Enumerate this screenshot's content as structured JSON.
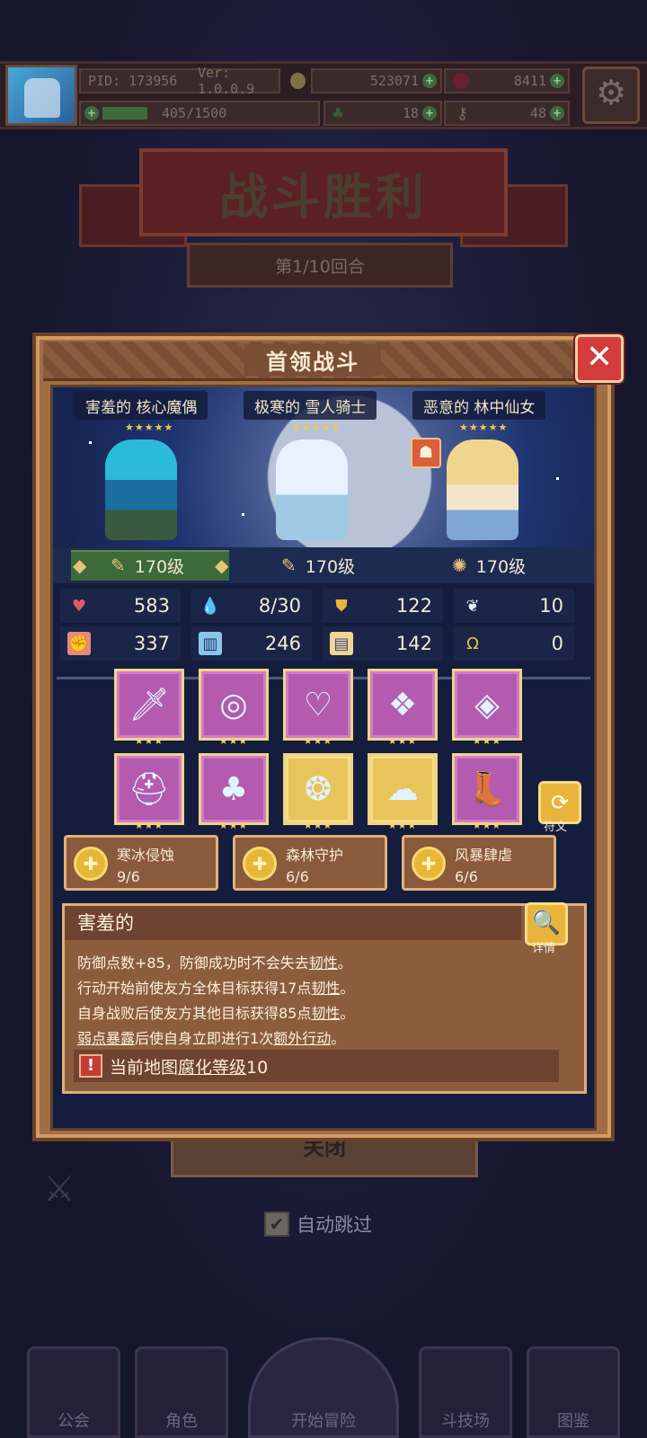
{
  "header": {
    "pid": "PID: 173956",
    "version": "Ver: 1.0.0.9",
    "gold": "523071",
    "gems": "8411",
    "energy": "405/1500",
    "clover": "18",
    "keys": "48"
  },
  "background": {
    "victory_title": "战斗胜利",
    "round": "第1/10回合",
    "close_label": "关闭",
    "auto_skip": "自动跳过",
    "nav": [
      "公会",
      "角色",
      "开始冒险",
      "斗技场",
      "图鉴"
    ]
  },
  "modal": {
    "title": "首领战斗",
    "heroes": [
      {
        "name": "害羞的 核心魔偶",
        "stars": "★★★★★",
        "level": "170级"
      },
      {
        "name": "极寒的 雪人骑士",
        "stars": "★★★★★",
        "level": "170级"
      },
      {
        "name": "恶意的 林中仙女",
        "stars": "★★★★★",
        "level": "170级"
      }
    ],
    "stats": {
      "hp": "583",
      "mana": "8/30",
      "defense": "122",
      "speed": "10",
      "attack": "337",
      "magic": "246",
      "armor": "142",
      "luck": "0"
    },
    "equipment_stars": "★★★",
    "rune_label": "符文",
    "sets": [
      {
        "name": "寒冰侵蚀",
        "count": "9/6"
      },
      {
        "name": "森林守护",
        "count": "6/6"
      },
      {
        "name": "风暴肆虐",
        "count": "6/6"
      }
    ],
    "trait": {
      "title": "害羞的",
      "detail_label": "详情",
      "lines": [
        {
          "a": "防御点数+85，防御成功时不会失去",
          "u": "韧性",
          "b": "。"
        },
        {
          "a": "行动开始前使友方全体目标获得17点",
          "u": "韧性",
          "b": "。"
        },
        {
          "a": "自身战败后使友方其他目标获得85点",
          "u": "韧性",
          "b": "。"
        },
        {
          "a": "",
          "u": "弱点暴露",
          "b": "后使自身立即进行1次",
          "u2": "额外行动",
          "c": "。"
        }
      ],
      "warning_a": "当前地图",
      "warning_u": "腐化等级",
      "warning_b": "10"
    }
  },
  "colors": {
    "modal_frame": "#a06d45",
    "close_red": "#d43b3b",
    "star_gold": "#f4c94a",
    "epic_purple": "#b45bb0",
    "legend_gold": "#e8c45a"
  }
}
